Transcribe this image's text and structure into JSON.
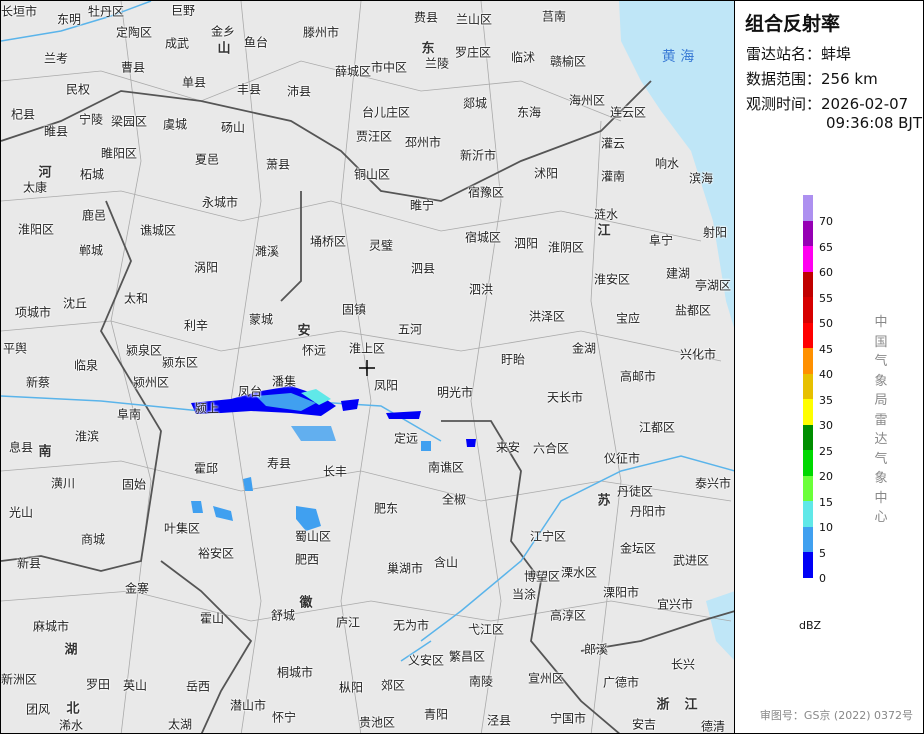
{
  "panel": {
    "title": "组合反射率",
    "station_label": "雷达站名：",
    "station": "蚌埠",
    "range_label": "数据范围：",
    "range": "256 km",
    "time_label": "观测时间：",
    "date": "2026-02-07",
    "time": "09:36:08 BJT",
    "unit": "dBZ",
    "vertical": "中国气象局雷达气象中心",
    "copyright": "审图号：GS京 (2022) 0372号"
  },
  "legend": {
    "colors": [
      "#ad90f0",
      "#9600b4",
      "#ff00f0",
      "#c00000",
      "#d60000",
      "#ff0000",
      "#ff9000",
      "#e7c000",
      "#ffff00",
      "#008e00",
      "#00d800",
      "#6bff3a",
      "#60e8e8",
      "#40a0f0",
      "#0000f6"
    ],
    "ticks": [
      "70",
      "65",
      "60",
      "55",
      "50",
      "45",
      "40",
      "35",
      "30",
      "25",
      "20",
      "15",
      "10",
      "5",
      "0"
    ]
  },
  "map": {
    "sea": "黄 海",
    "provinces": [
      "山",
      "东",
      "河",
      "南",
      "安",
      "徽",
      "江",
      "苏",
      "湖",
      "北",
      "浙",
      "江"
    ],
    "labels": [
      "长垣市",
      "东明",
      "牡丹区",
      "巨野",
      "金乡",
      "鱼台",
      "滕州市",
      "费县",
      "兰山区",
      "莒南",
      "定陶区",
      "成武",
      "曹县",
      "单县",
      "丰县",
      "沛县",
      "薛城区",
      "市中区",
      "兰陵",
      "罗庄区",
      "临沭",
      "赣榆区",
      "兰考",
      "民权",
      "杞县",
      "宁陵",
      "梁园区",
      "虞城",
      "砀山",
      "台儿庄区",
      "郯城",
      "东海",
      "海州区",
      "连云区",
      "睢县",
      "睢阳区",
      "夏邑",
      "萧县",
      "贾汪区",
      "邳州市",
      "新沂市",
      "沭阳",
      "灌云",
      "响水",
      "滨海",
      "太康",
      "柘城",
      "铜山区",
      "宿豫区",
      "灌南",
      "永城市",
      "睢宁",
      "涟水",
      "淮阳区",
      "鹿邑",
      "谯城区",
      "濉溪",
      "埇桥区",
      "灵璧",
      "宿城区",
      "泗阳",
      "淮阴区",
      "阜宁",
      "射阳",
      "郸城",
      "涡阳",
      "泗县",
      "淮安区",
      "建湖",
      "亭湖区",
      "太和",
      "沈丘",
      "蒙城",
      "固镇",
      "泗洪",
      "洪泽区",
      "宝应",
      "盐都区",
      "项城市",
      "利辛",
      "五河",
      "平舆",
      "颍泉区",
      "怀远",
      "淮上区",
      "盱眙",
      "金湖",
      "兴化市",
      "临泉",
      "颍东区",
      "新蔡",
      "颍州区",
      "凤台",
      "潘集",
      "凤阳",
      "明光市",
      "高邮市",
      "天长市",
      "阜南",
      "颍上",
      "定远",
      "江都区",
      "来安",
      "六合区",
      "仪征市",
      "息县",
      "淮滨",
      "霍邱",
      "寿县",
      "长丰",
      "南谯区",
      "泰兴市",
      "潢川",
      "固始",
      "肥东",
      "全椒",
      "丹徒区",
      "丹阳市",
      "光山",
      "叶集区",
      "蜀山区",
      "江宁区",
      "金坛区",
      "商城",
      "裕安区",
      "肥西",
      "巢湖市",
      "含山",
      "博望区",
      "溧水区",
      "武进区",
      "新县",
      "金寨",
      "当涂",
      "溧阳市",
      "宜兴市",
      "霍山",
      "舒城",
      "庐江",
      "无为市",
      "弋江区",
      "高淳区",
      "麻城市",
      "郎溪",
      "长兴",
      "新洲区",
      "罗田",
      "英山",
      "岳西",
      "桐城市",
      "枞阳",
      "繁昌区",
      "南陵",
      "宣州区",
      "广德市",
      "团风",
      "浠水",
      "潜山市",
      "怀宁",
      "太湖",
      "贵池区",
      "青阳",
      "泾县",
      "宁国市",
      "安吉",
      "德清",
      "义安区",
      "郊区"
    ]
  }
}
